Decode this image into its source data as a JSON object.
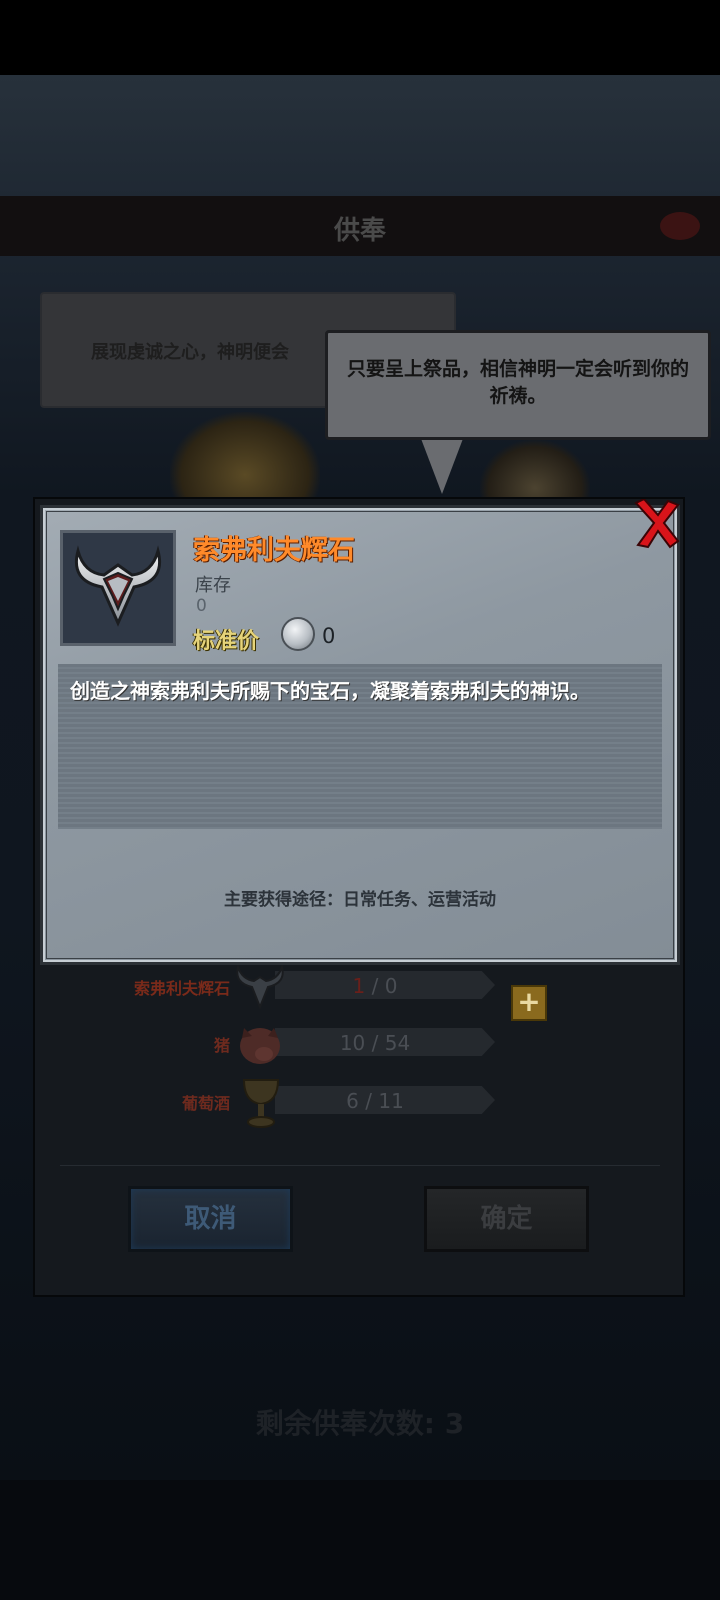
{
  "background": {
    "header_title": "供奉",
    "bubble_left_text": "展现虔诚之心，神明便会",
    "bubble_right_text": "只要呈上祭品，相信神明一定会听到你的祈祷。",
    "remaining_text": "剩余供奉次数: 3"
  },
  "item_card": {
    "name": "索弗利夫辉石",
    "stock_label": "库存",
    "stock_value": "0",
    "price_label": "标准价",
    "price_value": "0",
    "description": "创造之神索弗利夫所赐下的宝石，凝聚着索弗利夫的神识。",
    "source": "主要获得途径：日常任务、运营活动"
  },
  "requirements": [
    {
      "name": "索弗利夫辉石",
      "have": "1",
      "sep": " / ",
      "need": "0",
      "icon": "horned-gem-icon"
    },
    {
      "name": "猪",
      "count": "10 / 54",
      "icon": "pig-icon"
    },
    {
      "name": "葡萄酒",
      "count": "6 / 11",
      "icon": "goblet-icon"
    }
  ],
  "buttons": {
    "cancel": "取消",
    "confirm": "确定",
    "plus": "+"
  },
  "colors": {
    "item_name": "#ff8a2a",
    "price_label": "#e6d47a",
    "close_red": "#d8141a"
  }
}
